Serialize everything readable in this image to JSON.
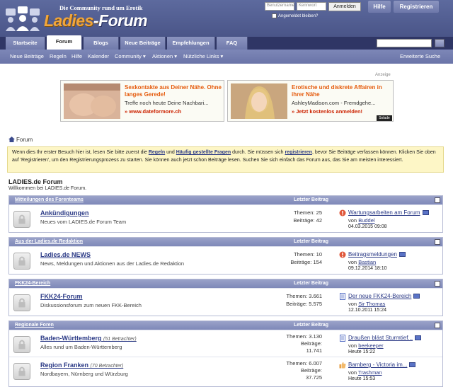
{
  "header": {
    "tagline": "Die Community rund um Erotik",
    "logo_main": "Ladies",
    "logo_dash": "-",
    "logo_forum": "Forum",
    "login": {
      "username_placeholder": "Benutzername",
      "password_placeholder": "Kennwort",
      "login_button": "Anmelden",
      "remember_label": "Angemeldet bleiben?"
    },
    "help_button": "Hilfe",
    "register_button": "Registrieren"
  },
  "nav": {
    "tabs": [
      "Startseite",
      "Forum",
      "Blogs",
      "Neue Beiträge",
      "Empfehlungen",
      "FAQ"
    ],
    "active_tab": "Forum"
  },
  "subnav": {
    "items": [
      "Neue Beiträge",
      "Regeln",
      "Hilfe",
      "Kalender",
      "Community ▾",
      "Aktionen ▾",
      "Nützliche Links ▾"
    ],
    "advanced_search": "Erweiterte Suche"
  },
  "ads": {
    "label": "Anzeige",
    "ad1": {
      "title": "Sexkontakte aus Deiner Nähe. Ohne langes Gerede!",
      "text": "Treffe noch heute Deine Nachbari...",
      "link": "» www.dateformore.ch"
    },
    "ad2": {
      "title": "Erotische und diskrete Affairen in ihrer Nähe",
      "text": "AshleyMadison.com - Fremdgehe...",
      "link": "» Jetzt kostenlos anmelden!"
    },
    "badge": "Solade"
  },
  "breadcrumb": "Forum",
  "notice": {
    "p1": "Wenn dies Ihr erster Besuch hier ist, lesen Sie bitte zuerst die ",
    "l1": "Regeln",
    "p2": " und ",
    "l2": "Häufig gestellte Fragen",
    "p3": " durch. Sie müssen sich ",
    "l3": "registrieren",
    "p4": ", bevor Sie Beiträge verfassen können. Klicken Sie oben auf 'Registrieren', um den Registrierungsprozess zu starten. Sie können auch jetzt schon Beiträge lesen. Suchen Sie sich einfach das Forum aus, das Sie am meisten interessiert."
  },
  "forum_title": "LADIES.de Forum",
  "forum_subtitle": "Willkommen bei LADIES.de Forum.",
  "last_post_header": "Letzter Beitrag",
  "categories": [
    {
      "name": "Mitteilungen des Forenteams",
      "forums": [
        {
          "name": "Ankündigungen",
          "viewers": "",
          "desc": "Neues vom LADIES.de Forum Team",
          "threads_label": "Themen:",
          "threads": "25",
          "posts_label": "Beiträge:",
          "posts": "42",
          "last_title": "Wartungsarbeiten am Forum",
          "last_by_label": "von",
          "last_by": "Buddel",
          "last_date": "04.03.2015 09:08"
        }
      ]
    },
    {
      "name": "Aus der Ladies.de Redaktion",
      "forums": [
        {
          "name": "Ladies.de NEWS",
          "viewers": "",
          "desc": "News, Meldungen und Aktionen aus der Ladies.de Redaktion",
          "threads_label": "Themen:",
          "threads": "10",
          "posts_label": "Beiträge:",
          "posts": "154",
          "last_title": "Beitragsmeldungen",
          "last_by_label": "von",
          "last_by": "Bastian",
          "last_date": "09.12.2014 18:10"
        }
      ]
    },
    {
      "name": "FKK24-Bereich",
      "forums": [
        {
          "name": "FKK24-Forum",
          "viewers": "",
          "desc": "Diskussionsforum zum neuen FKK-Bereich",
          "threads_label": "Themen:",
          "threads": "3.661",
          "posts_label": "Beiträge:",
          "posts": "5.575",
          "last_title": "Der neue FKK24-Bereich",
          "last_by_label": "von",
          "last_by": "Sir Thomas",
          "last_date": "12.10.2011 15:24"
        }
      ]
    },
    {
      "name": "Regionale Foren",
      "forums": [
        {
          "name": "Baden-Württemberg",
          "viewers": "(51 Betrachter)",
          "desc": "Alles rund um Baden-Württemberg",
          "threads_label": "Themen:",
          "threads": "3.130",
          "posts_label": "Beiträge:",
          "posts": "11.741",
          "last_title": "Draußen bläst Sturmtief...",
          "last_by_label": "von",
          "last_by": "beekeeper",
          "last_date": "Heute 15:22"
        },
        {
          "name": "Region Franken",
          "viewers": "(70 Betrachter)",
          "desc": "Nordbayern, Nürnberg und Würzburg",
          "threads_label": "Themen:",
          "threads": "6.007",
          "posts_label": "Beiträge:",
          "posts": "37.725",
          "last_title": "Bamberg - Victoria im...",
          "last_by_label": "von",
          "last_by": "Trashman",
          "last_date": "Heute 15:53"
        }
      ]
    }
  ],
  "colors": {
    "header_bg": "#4a5588",
    "nav_bg": "#2f3665",
    "link": "#2b3a86",
    "ad_title": "#e55a0b",
    "notice_bg": "#fdf6c6"
  }
}
